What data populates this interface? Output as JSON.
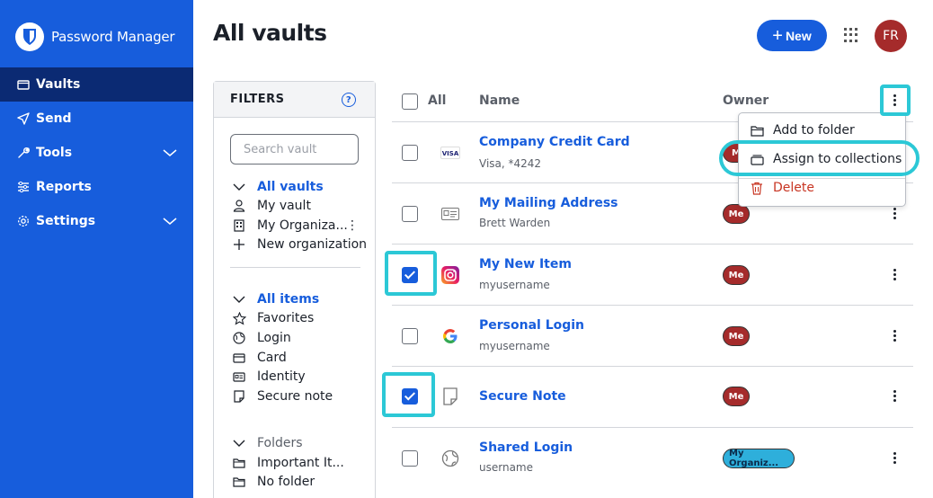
{
  "app": {
    "name": "Password Manager"
  },
  "sidebar": {
    "items": [
      {
        "label": "Vaults",
        "icon": "vault-icon",
        "active": true
      },
      {
        "label": "Send",
        "icon": "send-icon"
      },
      {
        "label": "Tools",
        "icon": "tools-icon",
        "expandable": true
      },
      {
        "label": "Reports",
        "icon": "reports-icon"
      },
      {
        "label": "Settings",
        "icon": "gear-icon",
        "expandable": true
      }
    ]
  },
  "header": {
    "title": "All vaults",
    "new_label": "New",
    "avatar_initials": "FR"
  },
  "filters": {
    "title": "FILTERS",
    "search_placeholder": "Search vault",
    "vaults": {
      "heading": "All vaults",
      "items": [
        "My vault",
        "My Organiza...",
        "New organization"
      ]
    },
    "types": {
      "heading": "All items",
      "items": [
        "Favorites",
        "Login",
        "Card",
        "Identity",
        "Secure note"
      ]
    },
    "folders": {
      "heading": "Folders",
      "items": [
        "Important It...",
        "No folder"
      ]
    }
  },
  "table": {
    "headers": {
      "all": "All",
      "name": "Name",
      "owner": "Owner"
    },
    "rows": [
      {
        "name": "Company Credit Card",
        "sub": "Visa, *4242",
        "icon": "visa-card-icon",
        "owner": "Me",
        "checked": false
      },
      {
        "name": "My Mailing Address",
        "sub": "Brett Warden",
        "icon": "identity-card-icon",
        "owner": "Me",
        "checked": false
      },
      {
        "name": "My New Item",
        "sub": "myusername",
        "icon": "instagram-icon",
        "owner": "Me",
        "checked": true
      },
      {
        "name": "Personal Login",
        "sub": "myusername",
        "icon": "google-icon",
        "owner": "Me",
        "checked": false
      },
      {
        "name": "Secure Note",
        "sub": "",
        "icon": "note-icon",
        "owner": "Me",
        "checked": true
      },
      {
        "name": "Shared Login",
        "sub": "username",
        "icon": "globe-icon",
        "owner": "My Organiz...",
        "checked": false
      }
    ]
  },
  "menu": {
    "items": [
      {
        "label": "Add to folder",
        "icon": "folder-icon"
      },
      {
        "label": "Assign to collections",
        "icon": "collection-icon"
      },
      {
        "label": "Delete",
        "icon": "trash-icon"
      }
    ]
  },
  "visa_text": "VISA",
  "owner_first_letter": "M",
  "colors": {
    "primary": "#175ddc",
    "sidebar_active": "#0b2a73",
    "highlight": "#2cc8d6",
    "danger": "#c83522",
    "owner_me": "#a52b2b",
    "owner_org": "#2eafdb"
  }
}
